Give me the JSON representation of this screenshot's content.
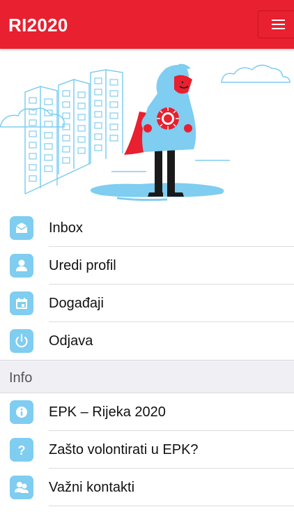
{
  "app": {
    "title": "RI2020",
    "menu_icon": "hamburger-menu-icon",
    "accent": "#e8202f",
    "icon_tile_color": "#7fcdf0"
  },
  "hero": {
    "illustration": "superhero-volunteer-illustration",
    "badge_icon": "sun-burst-icon"
  },
  "menu": {
    "items": [
      {
        "label": "Inbox",
        "icon": "envelope-icon"
      },
      {
        "label": "Uredi profil",
        "icon": "person-icon"
      },
      {
        "label": "Događaji",
        "icon": "calendar-icon"
      },
      {
        "label": "Odjava",
        "icon": "power-icon"
      }
    ]
  },
  "info": {
    "section_label": "Info",
    "items": [
      {
        "label": "EPK – Rijeka 2020",
        "icon": "info-icon"
      },
      {
        "label": "Zašto volontirati u EPK?",
        "icon": "question-icon"
      },
      {
        "label": "Važni kontakti",
        "icon": "contacts-icon"
      }
    ]
  }
}
